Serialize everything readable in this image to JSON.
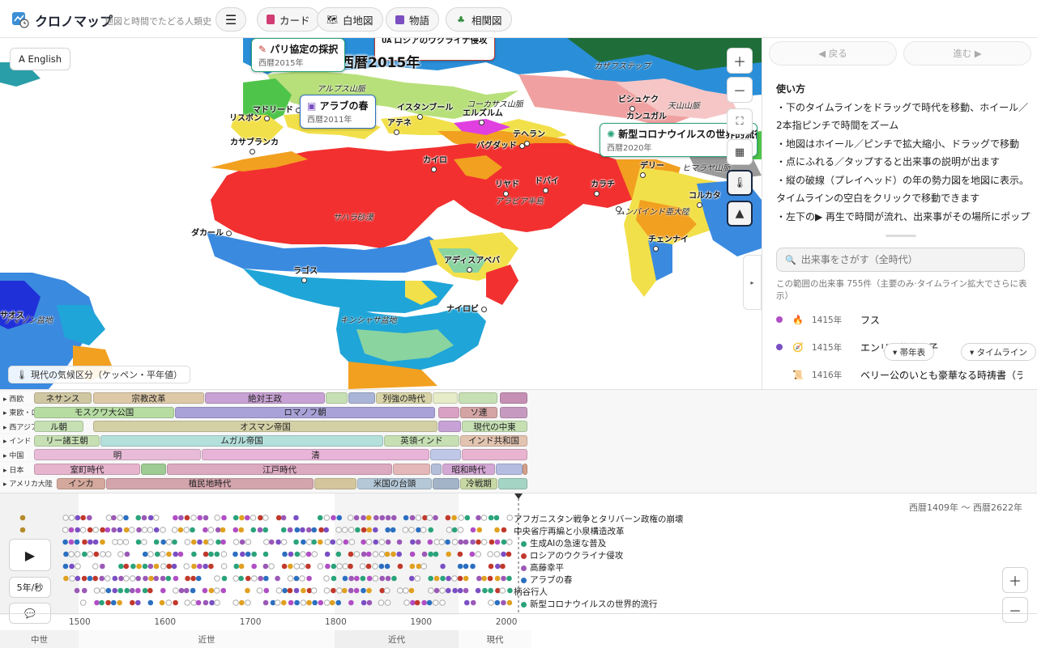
{
  "header": {
    "title": "クロノマップ",
    "subtitle": "地図と時間でたどる人類史",
    "nav": [
      {
        "label": "カード",
        "icon": "card-icon"
      },
      {
        "label": "白地図",
        "icon": "world-map-icon"
      },
      {
        "label": "物語",
        "icon": "story-icon"
      },
      {
        "label": "相関図",
        "icon": "tree-icon"
      }
    ]
  },
  "map": {
    "lang_button": "A English",
    "year": "西暦2015年",
    "legend": "現代の気候区分（ケッペン・平年値）",
    "events": [
      {
        "title": "パリ協定の採択",
        "date": "西暦2015年"
      },
      {
        "title": "アラブの春",
        "date": "西暦2011年"
      },
      {
        "title": "新型コロナウイルスの世界的流行",
        "date": "西暦2020年"
      },
      {
        "title": "ロシアのウクライナ侵攻",
        "date": ""
      }
    ],
    "regions": [
      "カザフステップ",
      "アルプス山脈",
      "コーカサス山脈",
      "天山山脈",
      "ヒマラヤ山脈",
      "サハラ砂漠",
      "アラビア半島",
      "ムンバインド亜大陸",
      "キンシャサ盆地",
      "アマゾン盆地"
    ],
    "cities": [
      "マドリード",
      "リスボン",
      "カサブランカ",
      "イスタンブール",
      "エルズルム",
      "アテネ",
      "バグダッド",
      "テヘラン",
      "ビシュケク",
      "カンユガル",
      "カイロ",
      "リヤド",
      "ドバイ",
      "カラチ",
      "デリー",
      "コルカタ",
      "ムンバイ",
      "チェンナイ",
      "ダカール",
      "ラゴス",
      "アディスアベバ",
      "ナイロビ",
      "サオス",
      "ラサ"
    ]
  },
  "side": {
    "back": "◀ 戻る",
    "forward": "進む ▶",
    "howto_title": "使い方",
    "howto": [
      "・下のタイムラインをドラッグで時代を移動、ホイール／2本指ピンチで時間をズーム",
      "・地図はホイール／ピンチで拡大縮小、ドラッグで移動",
      "・点にふれる／タップすると出来事の説明が出ます",
      "・縦の破線（プレイヘッド）の年の勢力図を地図に表示。タイムラインの空白をクリックで移動できます",
      "・左下の▶ 再生で時間が流れ、出来事がその場所にポップア"
    ],
    "search_placeholder": "出来事をさがす（全時代）",
    "count_info": "この範囲の出来事 755件（主要のみ·タイムライン拡大でさらに表示）",
    "events": [
      {
        "year": "1415年",
        "name": "フス",
        "color": "#b04fc4",
        "icon": "🔥"
      },
      {
        "year": "1415年",
        "name": "エンリケ航海王子",
        "color": "#7a4fc4",
        "icon": "🧭"
      },
      {
        "year": "1416年",
        "name": "ベリー公のいとも豪華なる時祷書（ラン…",
        "color": "",
        "icon": "📜"
      }
    ],
    "chronology_button": "▾ 帯年表",
    "timeline_button": "▾ タイムライン"
  },
  "bands": [
    {
      "label": "西欧",
      "segs": [
        {
          "t": "ネサンス",
          "c": "#cfc6a2"
        },
        {
          "t": "宗教改革",
          "c": "#ddc9a8"
        },
        {
          "t": "絶対王政",
          "c": "#c8a2d4"
        },
        {
          "t": "",
          "c": "#c6e0b4"
        },
        {
          "t": "",
          "c": "#a9b4d6"
        },
        {
          "t": "列強の時代",
          "c": "#d8d4a8"
        },
        {
          "t": "",
          "c": "#e6ebc8"
        },
        {
          "t": "",
          "c": "#c6e0b4"
        },
        {
          "t": "",
          "c": "#c590b4"
        }
      ]
    },
    {
      "label": "東欧・ロシア",
      "segs": [
        {
          "t": "モスクワ大公国",
          "c": "#b6dca2"
        },
        {
          "t": "ロマノフ朝",
          "c": "#a8a2d8"
        },
        {
          "t": "",
          "c": "#d9a2c4"
        },
        {
          "t": "ソ連",
          "c": "#d4a4a4"
        },
        {
          "t": "",
          "c": "#c69ac0"
        }
      ]
    },
    {
      "label": "西アジア",
      "segs": [
        {
          "t": "ル朝",
          "c": "#c6e0b4"
        },
        {
          "t": "オスマン帝国",
          "c": "#d4d0a6"
        },
        {
          "t": "",
          "c": "#c6a2d6"
        },
        {
          "t": "現代の中東",
          "c": "#c6e0b4"
        }
      ]
    },
    {
      "label": "インド",
      "segs": [
        {
          "t": "リー諸王朝",
          "c": "#c6e0b4"
        },
        {
          "t": "ムガル帝国",
          "c": "#b4e0dc"
        },
        {
          "t": "英領インド",
          "c": "#c6e0b4"
        },
        {
          "t": "インド共和国",
          "c": "#e2c4b0"
        }
      ]
    },
    {
      "label": "中国",
      "segs": [
        {
          "t": "明",
          "c": "#e8bcd8"
        },
        {
          "t": "清",
          "c": "#e8b4d8"
        },
        {
          "t": "",
          "c": "#c0c8e8"
        },
        {
          "t": "",
          "c": "#e8b4d0"
        }
      ]
    },
    {
      "label": "日本",
      "segs": [
        {
          "t": "室町時代",
          "c": "#e6b4cc"
        },
        {
          "t": "",
          "c": "#9ecb94"
        },
        {
          "t": "江戸時代",
          "c": "#dcaac0"
        },
        {
          "t": "",
          "c": "#e4b8b8"
        },
        {
          "t": "",
          "c": "#b4bed8"
        },
        {
          "t": "昭和時代",
          "c": "#d4a8d4"
        },
        {
          "t": "",
          "c": "#b4bce0"
        },
        {
          "t": "",
          "c": "#d4a08c"
        }
      ]
    },
    {
      "label": "アメリカ大陸",
      "segs": [
        {
          "t": "インカ",
          "c": "#d4a89c"
        },
        {
          "t": "植民地時代",
          "c": "#d4a4ac"
        },
        {
          "t": "",
          "c": "#d4c69c"
        },
        {
          "t": "米国の台頭",
          "c": "#b4c8d8"
        },
        {
          "t": "",
          "c": "#a4b4c8"
        },
        {
          "t": "冷戦期",
          "c": "#c8d8a4"
        },
        {
          "t": "",
          "c": "#a4d4c4"
        }
      ]
    }
  ],
  "timeline": {
    "range": "西暦1409年 〜 西暦2622年",
    "labels": [
      {
        "t": "アフガニスタン戦争とタリバーン政権の崩壊",
        "c": ""
      },
      {
        "t": "中央省庁再編と小泉構造改革",
        "c": ""
      },
      {
        "t": "生成AIの急速な普及",
        "c": "#2aa37a"
      },
      {
        "t": "ロシアのウクライナ侵攻",
        "c": "#c0392b"
      },
      {
        "t": "高藤幸平",
        "c": "#9b59b6"
      },
      {
        "t": "アラブの春",
        "c": "#2b6fc0"
      },
      {
        "t": "柄谷行人",
        "c": ""
      },
      {
        "t": "新型コロナウイルスの世界的流行",
        "c": "#2aa37a"
      }
    ],
    "speed": "5年/秒",
    "ticks": [
      "1500",
      "1600",
      "1700",
      "1800",
      "1900",
      "2000"
    ],
    "eras": [
      "中世",
      "近世",
      "近代",
      "現代"
    ]
  }
}
